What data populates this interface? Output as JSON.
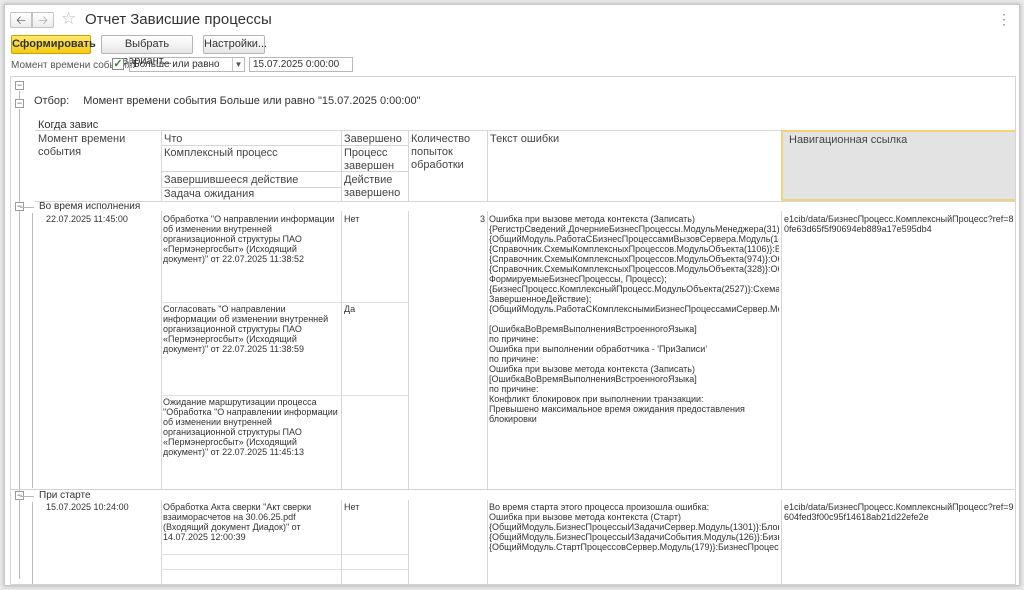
{
  "window": {
    "title": "Отчет Зависшие процессы",
    "back_icon": "arrow-left",
    "forward_icon": "arrow-right",
    "favorite_icon": "star"
  },
  "toolbar": {
    "generate_label": "Сформировать",
    "variant_label": "Выбрать вариант...",
    "settings_label": "Настройки..."
  },
  "filter": {
    "label": "Момент времени события:",
    "checked": true,
    "condition": "Больше или равно",
    "date": "15.07.2025  0:00:00"
  },
  "report": {
    "otbor_label": "Отбор:",
    "otbor_value": "Момент времени события Больше или равно \"15.07.2025 0:00:00\"",
    "section_title": "Когда завис",
    "headers": {
      "moment": "Момент времени события",
      "what": "Что",
      "complex_process": "Комплексный процесс",
      "finished_action": "Завершившееся действие",
      "wait_task": "Задача ожидания",
      "completed": "Завершено",
      "process_completed": "Процесс завершен",
      "action_completed": "Действие завершено",
      "attempts": "Количество попыток обработки",
      "error_text": "Текст ошибки",
      "nav_link": "Навигационная ссылка"
    },
    "groups": [
      {
        "label": "Во время исполнения",
        "moment": "22.07.2025 11:45:00",
        "what": [
          "Обработка \"О направлении информации об изменении внутренней организационной структуры ПАО «Пермэнергосбыт» (Исходящий документ)\" от 22.07.2025 11:38:52",
          "Согласовать \"О направлении информации об изменении внутренней организационной структуры ПАО «Пермэнергосбыт» (Исходящий документ)\" от 22.07.2025 11:38:59",
          "Ожидание маршрутизации процесса \"Обработка \"О направлении информации об изменении внутренней организационной структуры ПАО «Пермэнергосбыт» (Исходящий документ)\" от 22.07.2025 11:45:13"
        ],
        "completed": [
          "Нет",
          "Да"
        ],
        "attempts": "3",
        "error": "Ошибка при вызове метода контекста (Записать)\n{РегистрСведений.ДочерниеБизнесПроцессы.МодульМенеджера(31)}:НаборЗаписей.Записать();\n{ОбщийМодуль.РаботаСБизнесПроцессамиВызовСервера.Модуль(1802)}:РегистрСведений.ДочерниеБизнесПроцессы.Удалить(Источник.Ссылка);\n{Справочник.СхемыКомплексныхПроцессов.МодульОбъекта(1106)}:БизнесПроцесс.Записать();\n{Справочник.СхемыКомплексныхПроцессов.МодульОбъекта(974)}:ОбработатьЭлементДействиеСхемыПроцесса(\n{Справочник.СхемыКомплексныхПроцессов.МодульОбъекта(328)}:ОбработатьЭлементыСхемыПроцесса(ОчередьЭлементовСхемы, ФормируемыеБизнесПроцессы, Процесс);\n{БизнесПроцесс.КомплексныйПроцесс.МодульОбъекта(2527)}:СхемаОбъект.ПродолжитьВыполнениеПроцессаПоСхеме(ЭтотОбъект, ЗавершенноеДействие);\n{ОбщийМодуль.РаботаСКомплекснымиБизнесПроцессамиСервер.Модуль(2342)}:КомплексныйПроцессОбъект.ПродолжитьВыполнениеПроцессаПоСхеме(Выборка.ЗавершившеесяДействие);\n\n[ОшибкаВоВремяВыполненияВстроенногоЯзыка]\nпо причине:\nОшибка при выполнении обработчика - 'ПриЗаписи'\nпо причине:\nОшибка при вызове метода контекста (Записать)\n[ОшибкаВоВремяВыполненияВстроенногоЯзыка]\nпо причине:\nКонфликт блокировок при выполнении транзакции:\nПревышено максимальное время ожидания предоставления блокировки",
        "link": "e1cib/data/БизнесПроцесс.КомплексныйПроцесс?ref=80fe63d65f5f90694eb889a17e595db4"
      },
      {
        "label": "При старте",
        "moment": "15.07.2025 10:24:00",
        "what": [
          "Обработка Акта сверки \"Акт сверки взаиморасчетов на 30.06.25.pdf (Входящий документ Диадок)\" от 14.07.2025 12:00:39"
        ],
        "completed": [
          "Нет"
        ],
        "attempts": "",
        "error": "Во время старта этого процесса произошла ошибка:\nОшибка при вызове метода контекста (Старт)\n{ОбщийМодуль.БизнесПроцессыИЗадачиСервер.Модуль(1301)}:Блокировка.Заблокировать();\n{ОбщийМодуль.БизнесПроцессыИЗадачиСобытия.Модуль(126)}:БизнесПроцессыИЗадачиСервер.ПриЗаписиЗадачиСервер(Источник);\n{ОбщийМодуль.СтартПроцессовСервер.Модуль(179)}:БизнесПроцесс.Старт()",
        "link": "e1cib/data/БизнесПроцесс.КомплексныйПроцесс?ref=9604fed3f00c95f14618ab21d22efe2e"
      }
    ]
  }
}
